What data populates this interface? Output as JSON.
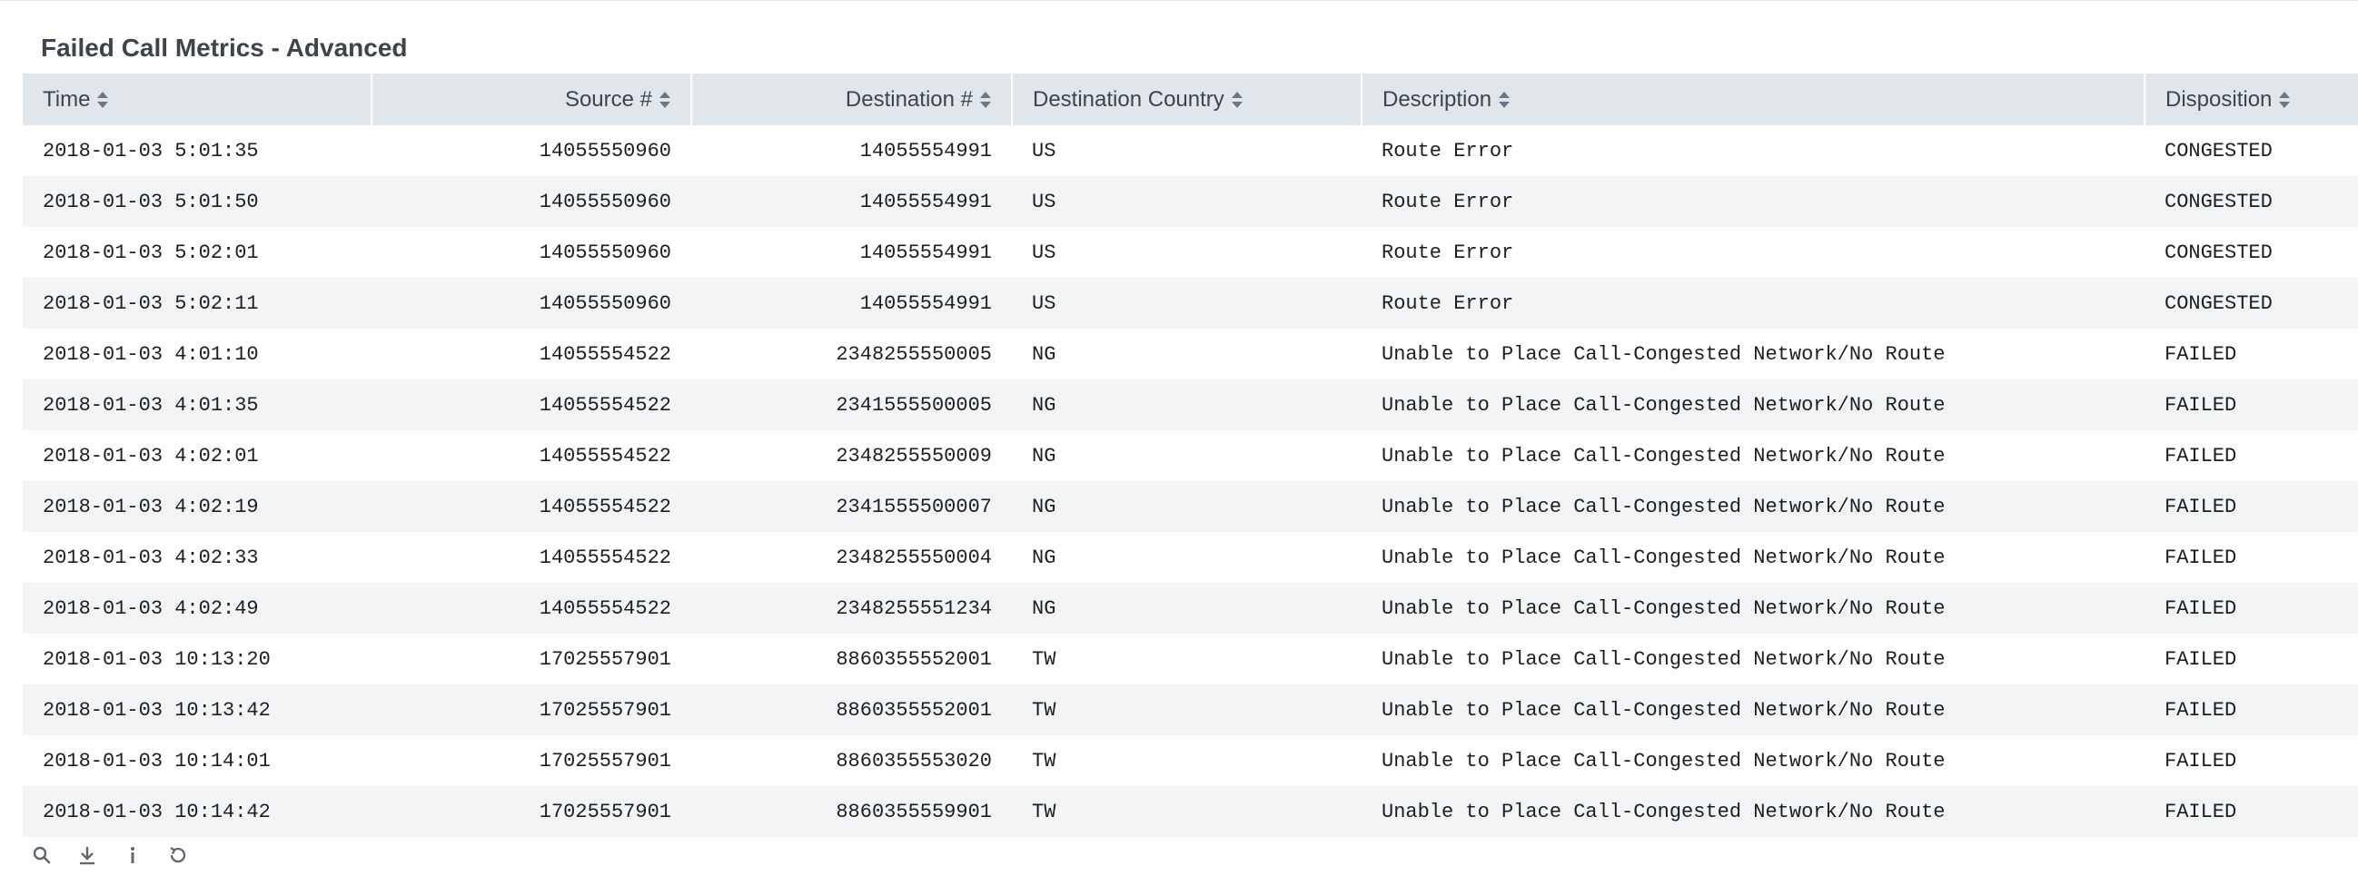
{
  "panel": {
    "title": "Failed Call Metrics - Advanced"
  },
  "table": {
    "columns": [
      "Time",
      "Source #",
      "Destination #",
      "Destination Country",
      "Description",
      "Disposition"
    ],
    "rows": [
      [
        "2018-01-03 5:01:35",
        "14055550960",
        "14055554991",
        "US",
        "Route Error",
        "CONGESTED"
      ],
      [
        "2018-01-03 5:01:50",
        "14055550960",
        "14055554991",
        "US",
        "Route Error",
        "CONGESTED"
      ],
      [
        "2018-01-03 5:02:01",
        "14055550960",
        "14055554991",
        "US",
        "Route Error",
        "CONGESTED"
      ],
      [
        "2018-01-03 5:02:11",
        "14055550960",
        "14055554991",
        "US",
        "Route Error",
        "CONGESTED"
      ],
      [
        "2018-01-03 4:01:10",
        "14055554522",
        "2348255550005",
        "NG",
        "Unable to Place Call-Congested Network/No Route",
        "FAILED"
      ],
      [
        "2018-01-03 4:01:35",
        "14055554522",
        "2341555500005",
        "NG",
        "Unable to Place Call-Congested Network/No Route",
        "FAILED"
      ],
      [
        "2018-01-03 4:02:01",
        "14055554522",
        "2348255550009",
        "NG",
        "Unable to Place Call-Congested Network/No Route",
        "FAILED"
      ],
      [
        "2018-01-03 4:02:19",
        "14055554522",
        "2341555500007",
        "NG",
        "Unable to Place Call-Congested Network/No Route",
        "FAILED"
      ],
      [
        "2018-01-03 4:02:33",
        "14055554522",
        "2348255550004",
        "NG",
        "Unable to Place Call-Congested Network/No Route",
        "FAILED"
      ],
      [
        "2018-01-03 4:02:49",
        "14055554522",
        "2348255551234",
        "NG",
        "Unable to Place Call-Congested Network/No Route",
        "FAILED"
      ],
      [
        "2018-01-03 10:13:20",
        "17025557901",
        "8860355552001",
        "TW",
        "Unable to Place Call-Congested Network/No Route",
        "FAILED"
      ],
      [
        "2018-01-03 10:13:42",
        "17025557901",
        "8860355552001",
        "TW",
        "Unable to Place Call-Congested Network/No Route",
        "FAILED"
      ],
      [
        "2018-01-03 10:14:01",
        "17025557901",
        "8860355553020",
        "TW",
        "Unable to Place Call-Congested Network/No Route",
        "FAILED"
      ],
      [
        "2018-01-03 10:14:42",
        "17025557901",
        "8860355559901",
        "TW",
        "Unable to Place Call-Congested Network/No Route",
        "FAILED"
      ]
    ]
  },
  "footer": {
    "icons": [
      "search-icon",
      "download-icon",
      "info-icon",
      "refresh-icon"
    ]
  },
  "colors": {
    "header_bg": "#e1e6eb",
    "stripe_bg": "#f2f4f5",
    "text": "#3c444d"
  }
}
